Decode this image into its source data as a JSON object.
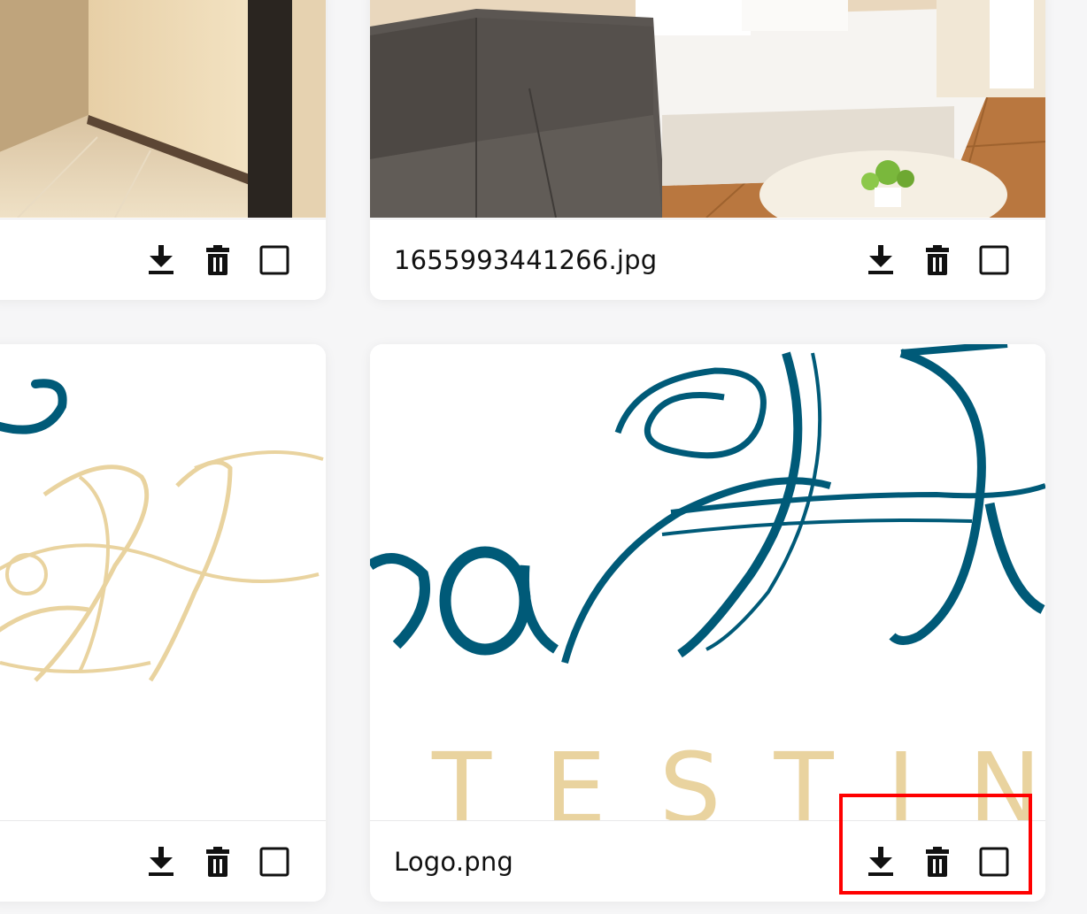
{
  "cards": [
    {
      "filename": ""
    },
    {
      "filename": "1655993441266.jpg"
    },
    {
      "filename": ""
    },
    {
      "filename": "Logo.png"
    }
  ],
  "logo_text": {
    "letters": "TESTING",
    "script": "aH"
  },
  "icons": {
    "download": "download-icon",
    "delete": "trash-icon",
    "select": "checkbox-icon"
  },
  "colors": {
    "logo_blue": "#005a78",
    "logo_gold": "#e9d39f",
    "highlight": "#ff0000"
  }
}
